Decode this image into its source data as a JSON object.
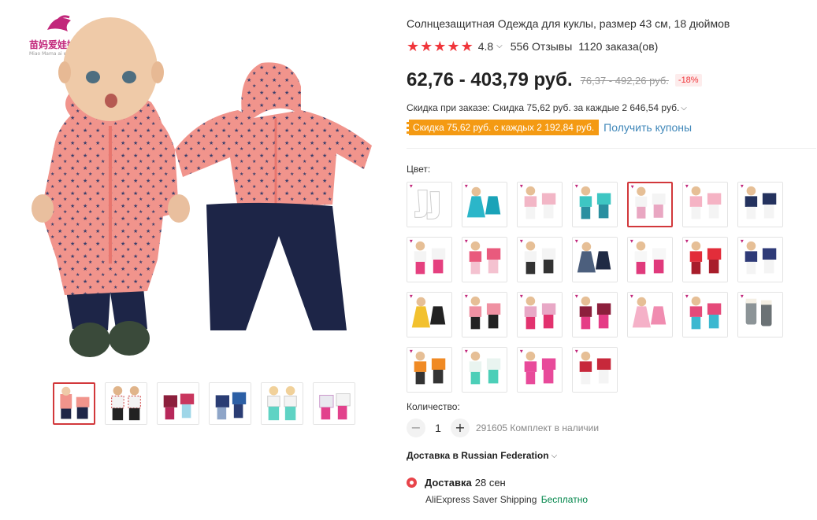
{
  "product": {
    "title": "Солнцезащитная Одежда для куклы, размер 43 см, 18 дюймов",
    "logo_text": "苗妈爱娃娃",
    "logo_subtext": "Miao Mama ai wa wa"
  },
  "rating": {
    "value": "4.8",
    "stars": 5,
    "reviews": "556 Отзывы",
    "orders": "1120 заказа(ов)"
  },
  "price": {
    "current": "62,76 - 403,79 руб.",
    "old": "76,37 - 492,26 руб.",
    "discount": "-18%"
  },
  "order_discount": {
    "text": "Скидка при заказе: Скидка 75,62 руб. за каждые 2 646,54 руб."
  },
  "coupon": {
    "badge": "Скидка 75,62 руб. с каждых 2 192,84 руб.",
    "link": "Получить купоны"
  },
  "color": {
    "label": "Цвет:",
    "selected_index": 4,
    "swatches": [
      "socks-white",
      "dress-teal",
      "jacket-pink",
      "outfit-teal",
      "outfit-pink-white",
      "outfit-pink",
      "overalls-navy",
      "outfit-white-pink",
      "jacket-floral",
      "outfit-white",
      "dress-denim",
      "jacket-pink-white",
      "outfit-red",
      "outfit-navy",
      "swimsuit",
      "jacket-pink-black",
      "outfit-pink-red",
      "outfit-burgundy",
      "dress-pink",
      "outfit-teal-pink",
      "boots-grey",
      "outfit-orange",
      "outfit-mint",
      "outfit-magenta",
      "outfit-cow"
    ]
  },
  "gallery": {
    "thumbnails": [
      "pink-star-outfit",
      "white-black-outfit",
      "burgundy-outfit",
      "navy-outfit",
      "mint-outfit",
      "pink-star-outfit-2"
    ],
    "active_index": 0
  },
  "quantity": {
    "label": "Количество:",
    "value": "1",
    "stock": "291605 Комплект в наличии"
  },
  "delivery": {
    "to": "Доставка в Russian Federation",
    "method_title": "Доставка",
    "date": "28 сен",
    "carrier": "AliExpress Saver Shipping",
    "price": "Бесплатно"
  },
  "colors": {
    "accent_red": "#f0353a",
    "coupon_orange": "#f49a13",
    "link_blue": "#3f87b9",
    "free_green": "#00864a",
    "selected_border": "#d2383b"
  }
}
